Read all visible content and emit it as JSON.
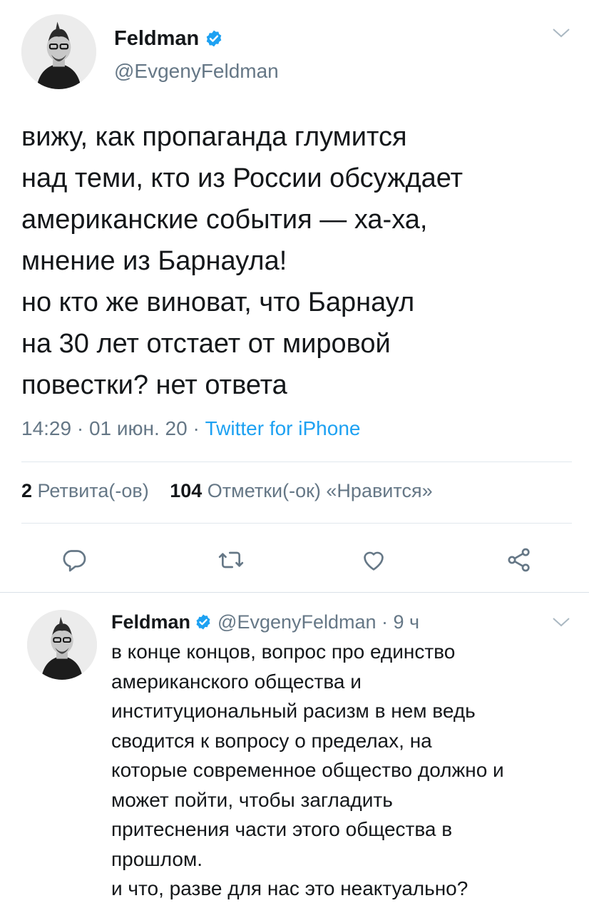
{
  "main_tweet": {
    "display_name": "Feldman",
    "handle": "@EvgenyFeldman",
    "text": "вижу, как пропаганда глумится\nнад теми, кто из России обсуждает\nамериканские события — ха-ха,\nмнение из Барнаула!\nно кто же виноват, что Барнаул\nна 30 лет отстает от мировой\nповестки? нет ответа",
    "time": "14:29",
    "date": "01 июн. 20",
    "sep1": "·",
    "sep2": "·",
    "source": "Twitter for iPhone",
    "retweets_count": "2",
    "retweets_label": "Ретвита(-ов)",
    "likes_count": "104",
    "likes_label": "Отметки(-ок) «Нравится»"
  },
  "reply_tweet": {
    "display_name": "Feldman",
    "handle_time": "@EvgenyFeldman · 9 ч",
    "text": "в конце концов, вопрос про единство\nамериканского общества и\nинституциональный расизм в нем ведь\nсводится к вопросу о пределах, на\nкоторые современное общество должно и\nможет пойти, чтобы загладить\nпритеснения части этого общества в\nпрошлом.\nи что, разве для нас это неактуально?"
  },
  "icons": {
    "verified": "verified-badge-icon",
    "menu": "chevron-down-icon",
    "reply": "reply-icon",
    "retweet": "retweet-icon",
    "like": "heart-icon",
    "share": "share-icon"
  },
  "colors": {
    "accent": "#1da1f2",
    "text": "#14171a",
    "secondary": "#657786",
    "divider": "#e1e8ed"
  }
}
